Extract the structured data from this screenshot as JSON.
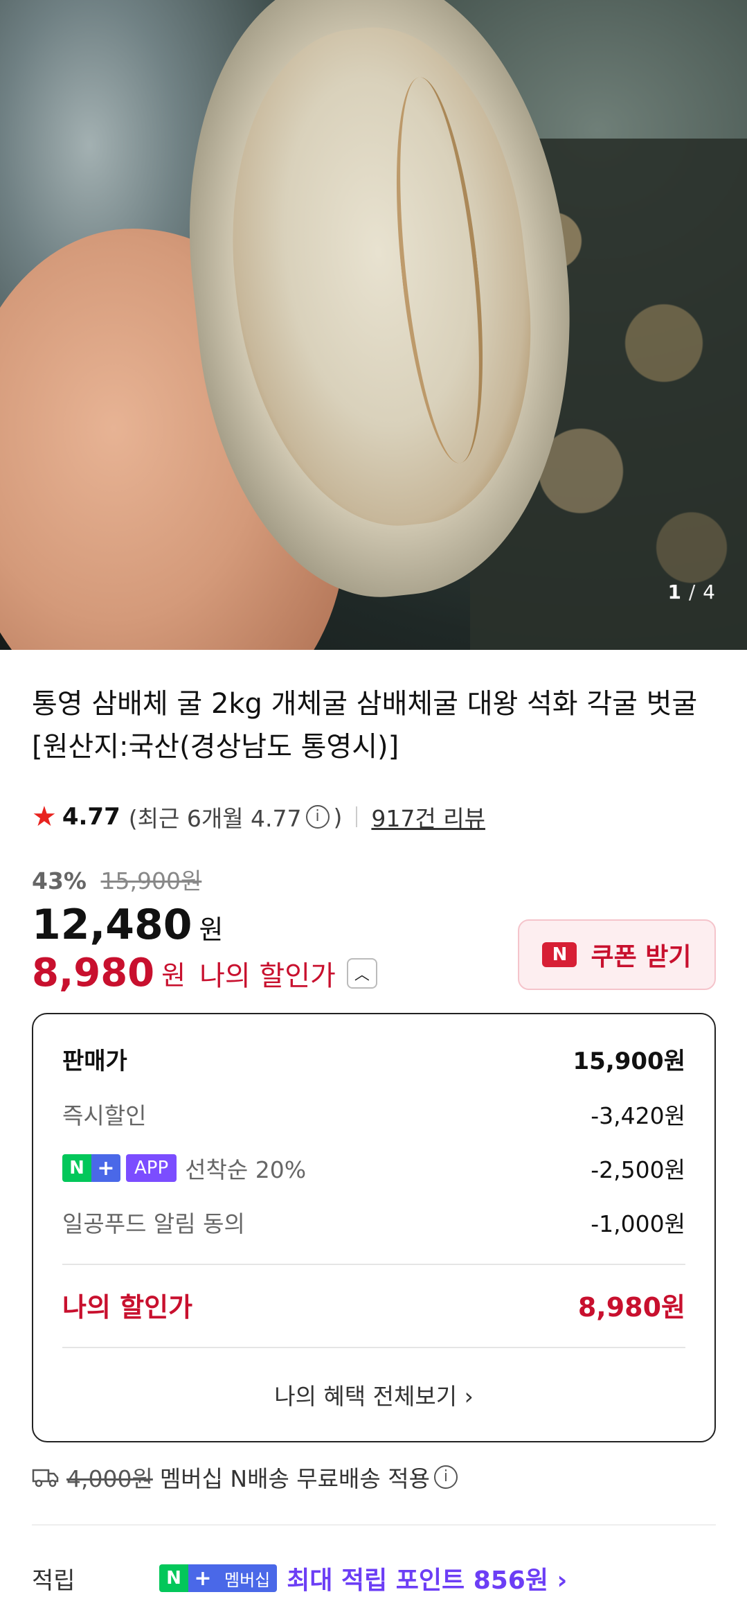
{
  "gallery": {
    "current": "1",
    "separator": "/",
    "total": "4"
  },
  "product": {
    "title": "통영 삼배체 굴 2kg 개체굴 삼배체굴 대왕 석화 각굴 벗굴 [원산지:국산(경상남도 통영시)]"
  },
  "rating": {
    "score": "4.77",
    "recent_open": "(최근 6개월 4.77",
    "recent_close": ")",
    "reviews": "917건 리뷰"
  },
  "price": {
    "discount_pct": "43%",
    "original": "15,900원",
    "sale": "12,480",
    "sale_unit": "원",
    "my_price": "8,980",
    "my_price_unit": "원",
    "my_price_label": "나의 할인가"
  },
  "coupon": {
    "icon_letter": "N",
    "label": "쿠폰 받기"
  },
  "breakdown": {
    "rows": [
      {
        "label": "판매가",
        "value": "15,900원"
      },
      {
        "label": "즉시할인",
        "value": "-3,420원"
      },
      {
        "badge_n": "N",
        "badge_plus": "+",
        "badge_app": "APP",
        "label": "선착순 20%",
        "value": "-2,500원"
      },
      {
        "label": "일공푸드 알림 동의",
        "value": "-1,000원"
      }
    ],
    "total_label": "나의 할인가",
    "total_value": "8,980원",
    "more": "나의 혜택 전체보기 ›"
  },
  "shipping": {
    "original_fee": "4,000원",
    "text": "멤버십 N배송 무료배송 적용"
  },
  "points": {
    "label": "적립",
    "badge_n": "N",
    "badge_plus": "+",
    "badge_membership": "멤버십",
    "text": "최대 적립 포인트 856원 ›"
  },
  "colors": {
    "accent_red": "#c8102e",
    "naver_green": "#03c75a",
    "point_purple": "#6c3ef5"
  }
}
